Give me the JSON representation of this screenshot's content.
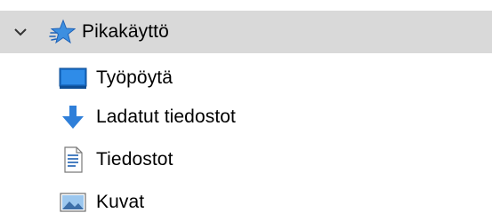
{
  "navigation_pane": {
    "quick_access": {
      "label": "Pikakäyttö",
      "icon": "star-icon",
      "expanded": true,
      "accent_color": "#3d8fe0"
    },
    "items": [
      {
        "label": "Työpöytä",
        "icon": "desktop-icon"
      },
      {
        "label": "Ladatut tiedostot",
        "icon": "download-arrow-icon"
      },
      {
        "label": "Tiedostot",
        "icon": "document-icon"
      },
      {
        "label": "Kuvat",
        "icon": "pictures-icon"
      }
    ],
    "selected_background": "#d9d9d9"
  }
}
